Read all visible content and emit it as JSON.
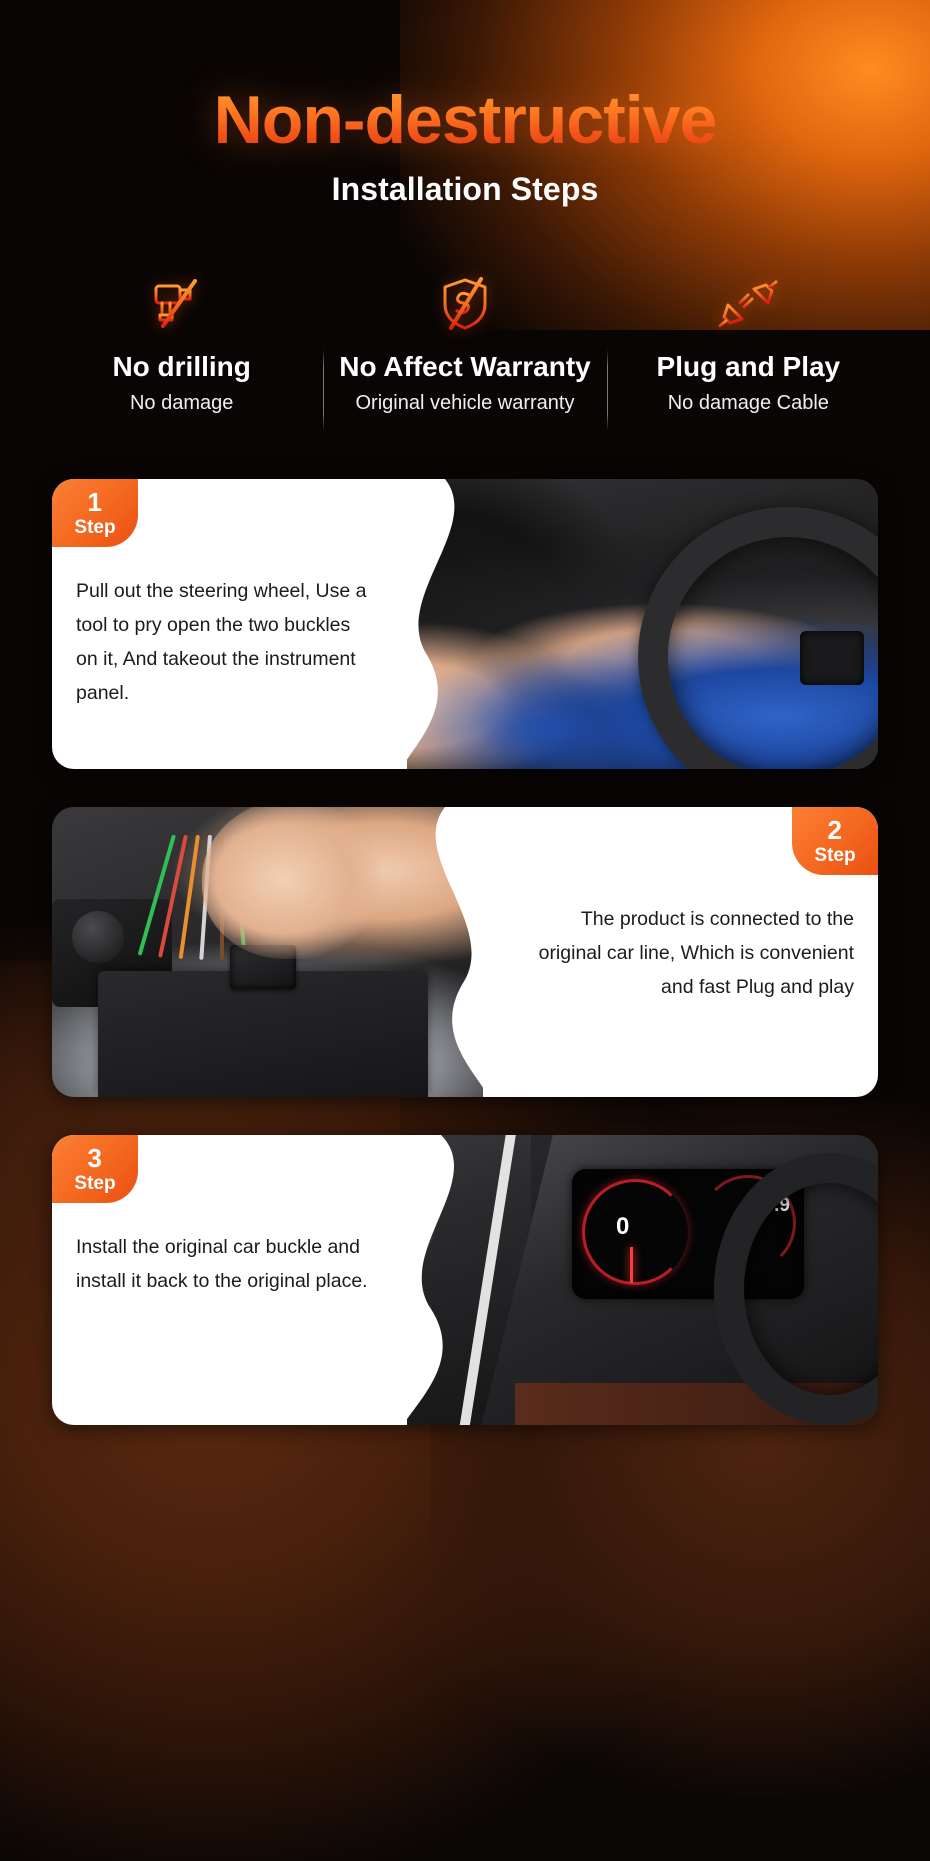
{
  "header": {
    "title_main": "Non-destructive",
    "title_sub": "Installation Steps"
  },
  "features": [
    {
      "icon": "no-drill-icon",
      "title": "No drilling",
      "subtitle": "No damage"
    },
    {
      "icon": "no-warranty-shield-icon",
      "title": "No Affect Warranty",
      "subtitle": "Original vehicle warranty"
    },
    {
      "icon": "plug-connector-icon",
      "title": "Plug and Play",
      "subtitle": "No damage Cable"
    }
  ],
  "steps": [
    {
      "number": "1",
      "word": "Step",
      "text": "Pull out the steering wheel, Use a tool to pry open the  two buckles on it, And takeout the instrument panel.",
      "panel_side": "left",
      "photo": "car-dashboard-pry-tool-photo"
    },
    {
      "number": "2",
      "word": "Step",
      "text": "The product is connected to the original car line, Which is convenient and fast Plug and play",
      "panel_side": "right",
      "photo": "wiring-harness-connector-photo"
    },
    {
      "number": "3",
      "word": "Step",
      "text": "Install the original car buckle and install it back to the original place.",
      "panel_side": "left",
      "photo": "reinstall-cluster-split-photo"
    }
  ],
  "cluster_readout": {
    "speed": "0",
    "value": "0.9"
  },
  "colors": {
    "accent_orange": "#f4671f",
    "accent_orange_light": "#fb8034",
    "title_gradient_top": "#ff9a32",
    "title_gradient_bottom": "#e8390f",
    "background_dark": "#0a0605",
    "panel_white": "#ffffff",
    "highlight_ring": "#f6a01b"
  }
}
